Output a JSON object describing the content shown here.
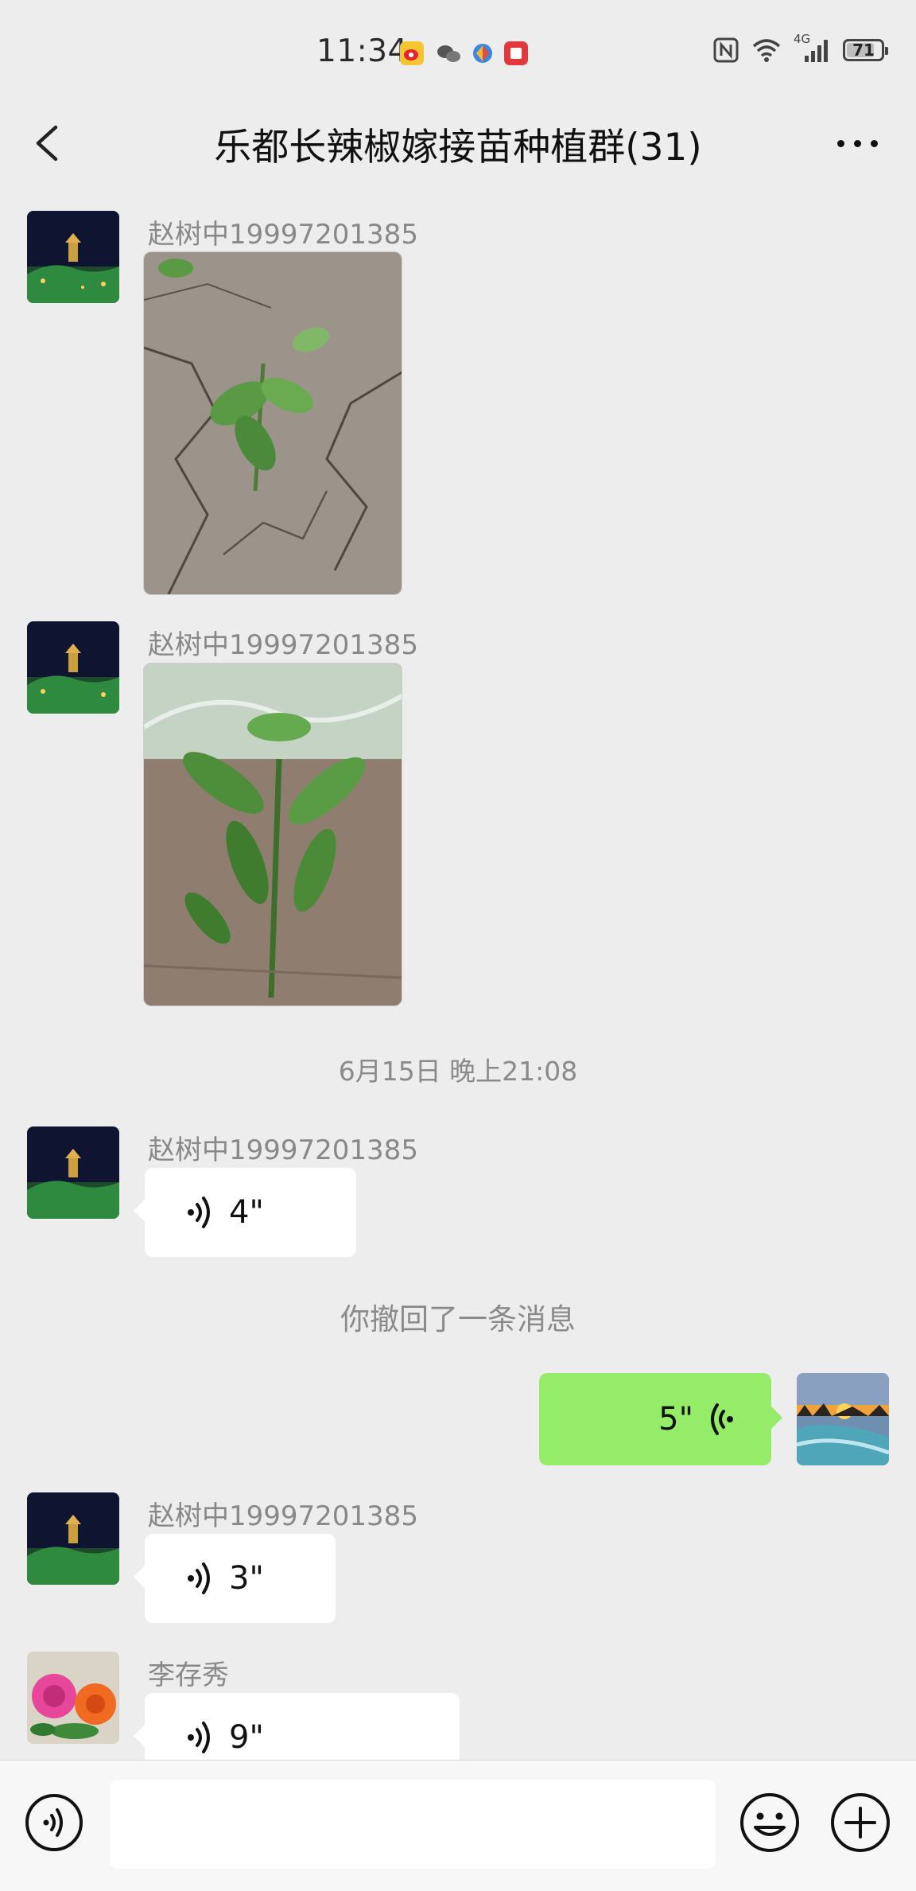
{
  "status_bar": {
    "time": "11:34",
    "network_label": "4G",
    "battery_level": "71"
  },
  "header": {
    "title": "乐都长辣椒嫁接苗种植群(31)"
  },
  "messages": [
    {
      "type": "image",
      "sender": "赵树中19997201385"
    },
    {
      "type": "image",
      "sender": "赵树中19997201385"
    },
    {
      "type": "timestamp",
      "text": "6月15日 晚上21:08"
    },
    {
      "type": "voice",
      "sender": "赵树中19997201385",
      "duration": "4\""
    },
    {
      "type": "recall",
      "text": "你撤回了一条消息"
    },
    {
      "type": "voice_self",
      "duration": "5\""
    },
    {
      "type": "voice",
      "sender": "赵树中19997201385",
      "duration": "3\""
    },
    {
      "type": "voice",
      "sender": "李存秀",
      "duration": "9\""
    }
  ],
  "colors": {
    "background": "#ededed",
    "self_bubble": "#95ec69",
    "other_bubble": "#ffffff",
    "meta_text": "#888888"
  },
  "icons": [
    "back-arrow-icon",
    "more-icon",
    "voice-wave-icon",
    "voice-mode-icon",
    "emoji-icon",
    "plus-icon"
  ]
}
